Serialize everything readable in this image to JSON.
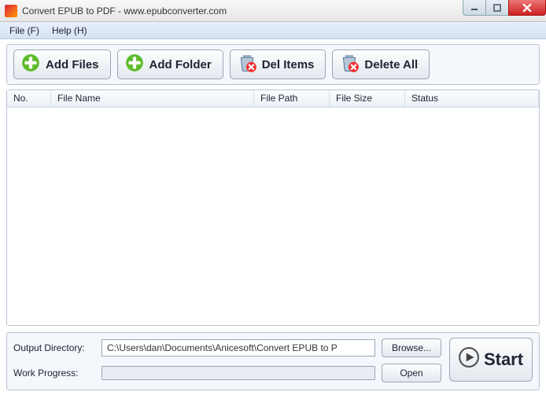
{
  "window": {
    "title": "Convert EPUB to PDF - www.epubconverter.com"
  },
  "menu": {
    "file": "File (F)",
    "help": "Help (H)"
  },
  "toolbar": {
    "add_files": "Add Files",
    "add_folder": "Add Folder",
    "del_items": "Del Items",
    "delete_all": "Delete All"
  },
  "columns": {
    "no": "No.",
    "file_name": "File Name",
    "file_path": "File Path",
    "file_size": "File Size",
    "status": "Status"
  },
  "rows": [],
  "output": {
    "label": "Output Directory:",
    "value": "C:\\Users\\dan\\Documents\\Anicesoft\\Convert EPUB to P",
    "browse": "Browse...",
    "open": "Open"
  },
  "progress": {
    "label": "Work Progress:"
  },
  "start": {
    "label": "Start"
  }
}
